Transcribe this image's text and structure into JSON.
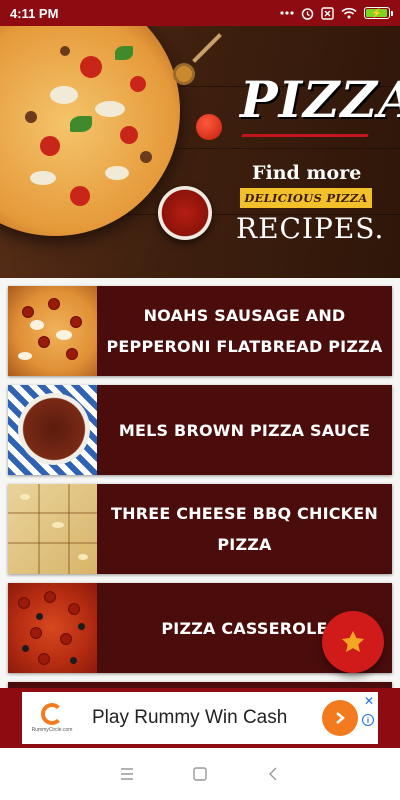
{
  "status_bar": {
    "time": "4:11 PM",
    "icons": [
      "dots-icon",
      "alarm-icon",
      "close-box-icon",
      "wifi-icon",
      "battery-charging-icon"
    ]
  },
  "banner": {
    "brand": "PIZZA",
    "find_more": "Find more",
    "delicious": "DELICIOUS PIZZA",
    "recipes": "RECIPES."
  },
  "recipes": [
    {
      "title": "NOAHS SAUSAGE AND PEPPERONI FLATBREAD PIZZA"
    },
    {
      "title": "MELS BROWN PIZZA SAUCE"
    },
    {
      "title": "THREE CHEESE BBQ CHICKEN PIZZA"
    },
    {
      "title": "PIZZA CASSEROLE"
    }
  ],
  "fab": {
    "icon": "star-icon"
  },
  "ad": {
    "logo_text": "RummyCircle.com",
    "text": "Play Rummy Win Cash",
    "cta_icon": "chevron-right-icon",
    "close": "✕",
    "info": "i"
  },
  "nav_bar": {
    "icons": [
      "menu-icon",
      "home-square-icon",
      "back-icon"
    ]
  },
  "colors": {
    "status_bar": "#8e0b12",
    "card": "#4a0d0c",
    "fab": "#d11a1a",
    "fab_star": "#f5a623",
    "ad_accent": "#f47a20"
  }
}
